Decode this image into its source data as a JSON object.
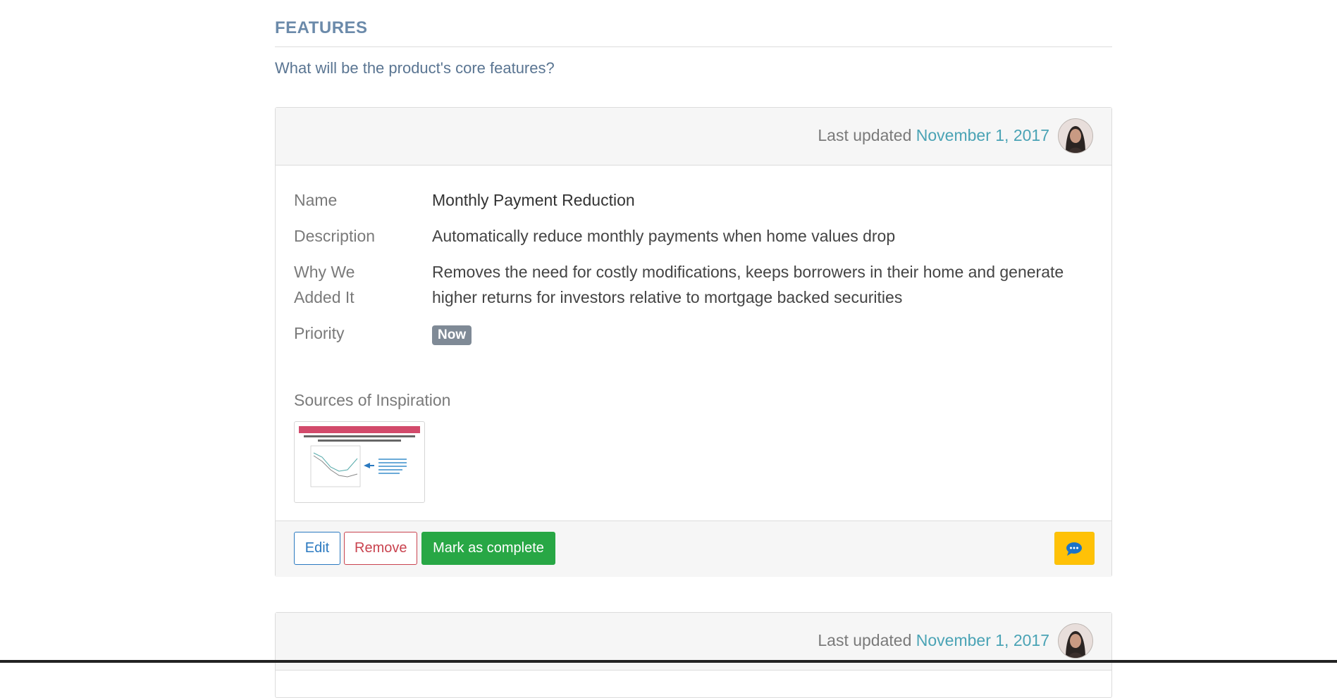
{
  "section": {
    "title": "FEATURES",
    "subtitle": "What will be the product's core features?"
  },
  "cards": [
    {
      "updated_prefix": "Last updated",
      "updated_date": "November 1, 2017",
      "fields": {
        "name_label": "Name",
        "name_value": "Monthly Payment Reduction",
        "description_label": "Description",
        "description_value": "Automatically reduce monthly payments when home values drop",
        "why_label": "Why We Added It",
        "why_value": "Removes the need for costly modifications, keeps borrowers in their home and generate higher returns for investors relative to mortgage backed securities",
        "priority_label": "Priority",
        "priority_value": "Now"
      },
      "sources_label": "Sources of Inspiration",
      "thumbnail_banner": "MONTHLY PAYMENT REDUCTION WORKS",
      "buttons": {
        "edit": "Edit",
        "remove": "Remove",
        "complete": "Mark as complete"
      }
    },
    {
      "updated_prefix": "Last updated",
      "updated_date": "November 1, 2017"
    }
  ],
  "colors": {
    "accent": "#4aa3b5",
    "success": "#28a745",
    "danger": "#c9434f",
    "primary": "#2a79c0",
    "warning": "#ffc107"
  },
  "icons": {
    "chat": "chat-bubble-icon",
    "avatar": "avatar"
  }
}
